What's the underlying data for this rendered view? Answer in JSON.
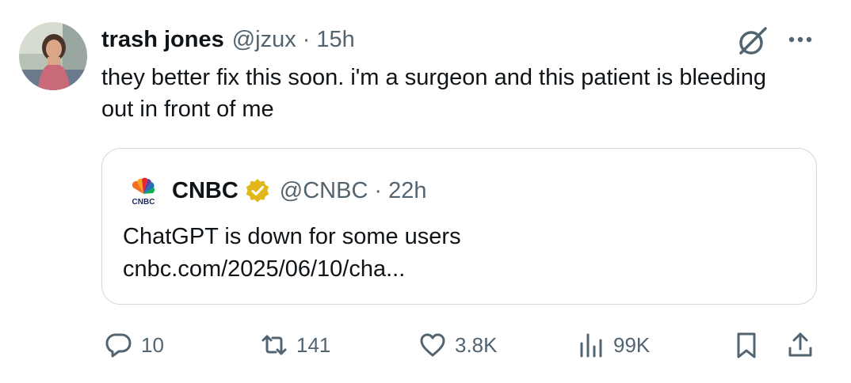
{
  "author": {
    "name": "trash jones",
    "handle": "@jzux",
    "separator": "·",
    "time": "15h",
    "avatar": "profile-photo"
  },
  "tweet": {
    "text": "they better fix this soon. i'm a surgeon and this patient is bleeding out in front of me"
  },
  "quote": {
    "logo": "cnbc-peacock-logo",
    "logo_text": "CNBC",
    "name": "CNBC",
    "verified": "gold-verified-badge",
    "handle": "@CNBC",
    "separator": "·",
    "time": "22h",
    "text": "ChatGPT is down for some users",
    "link": "cnbc.com/2025/06/10/cha..."
  },
  "actions": {
    "replies": "10",
    "reposts": "141",
    "likes": "3.8K",
    "views": "99K"
  },
  "icons": {
    "grok": "grok-icon",
    "more": "more-icon",
    "reply": "reply-icon",
    "repost": "repost-icon",
    "like": "heart-icon",
    "views": "views-icon",
    "bookmark": "bookmark-icon",
    "share": "share-icon"
  },
  "colors": {
    "text": "#0f1419",
    "secondary": "#536471",
    "border": "#cfd9de",
    "verified_gold": "#e2b719"
  }
}
